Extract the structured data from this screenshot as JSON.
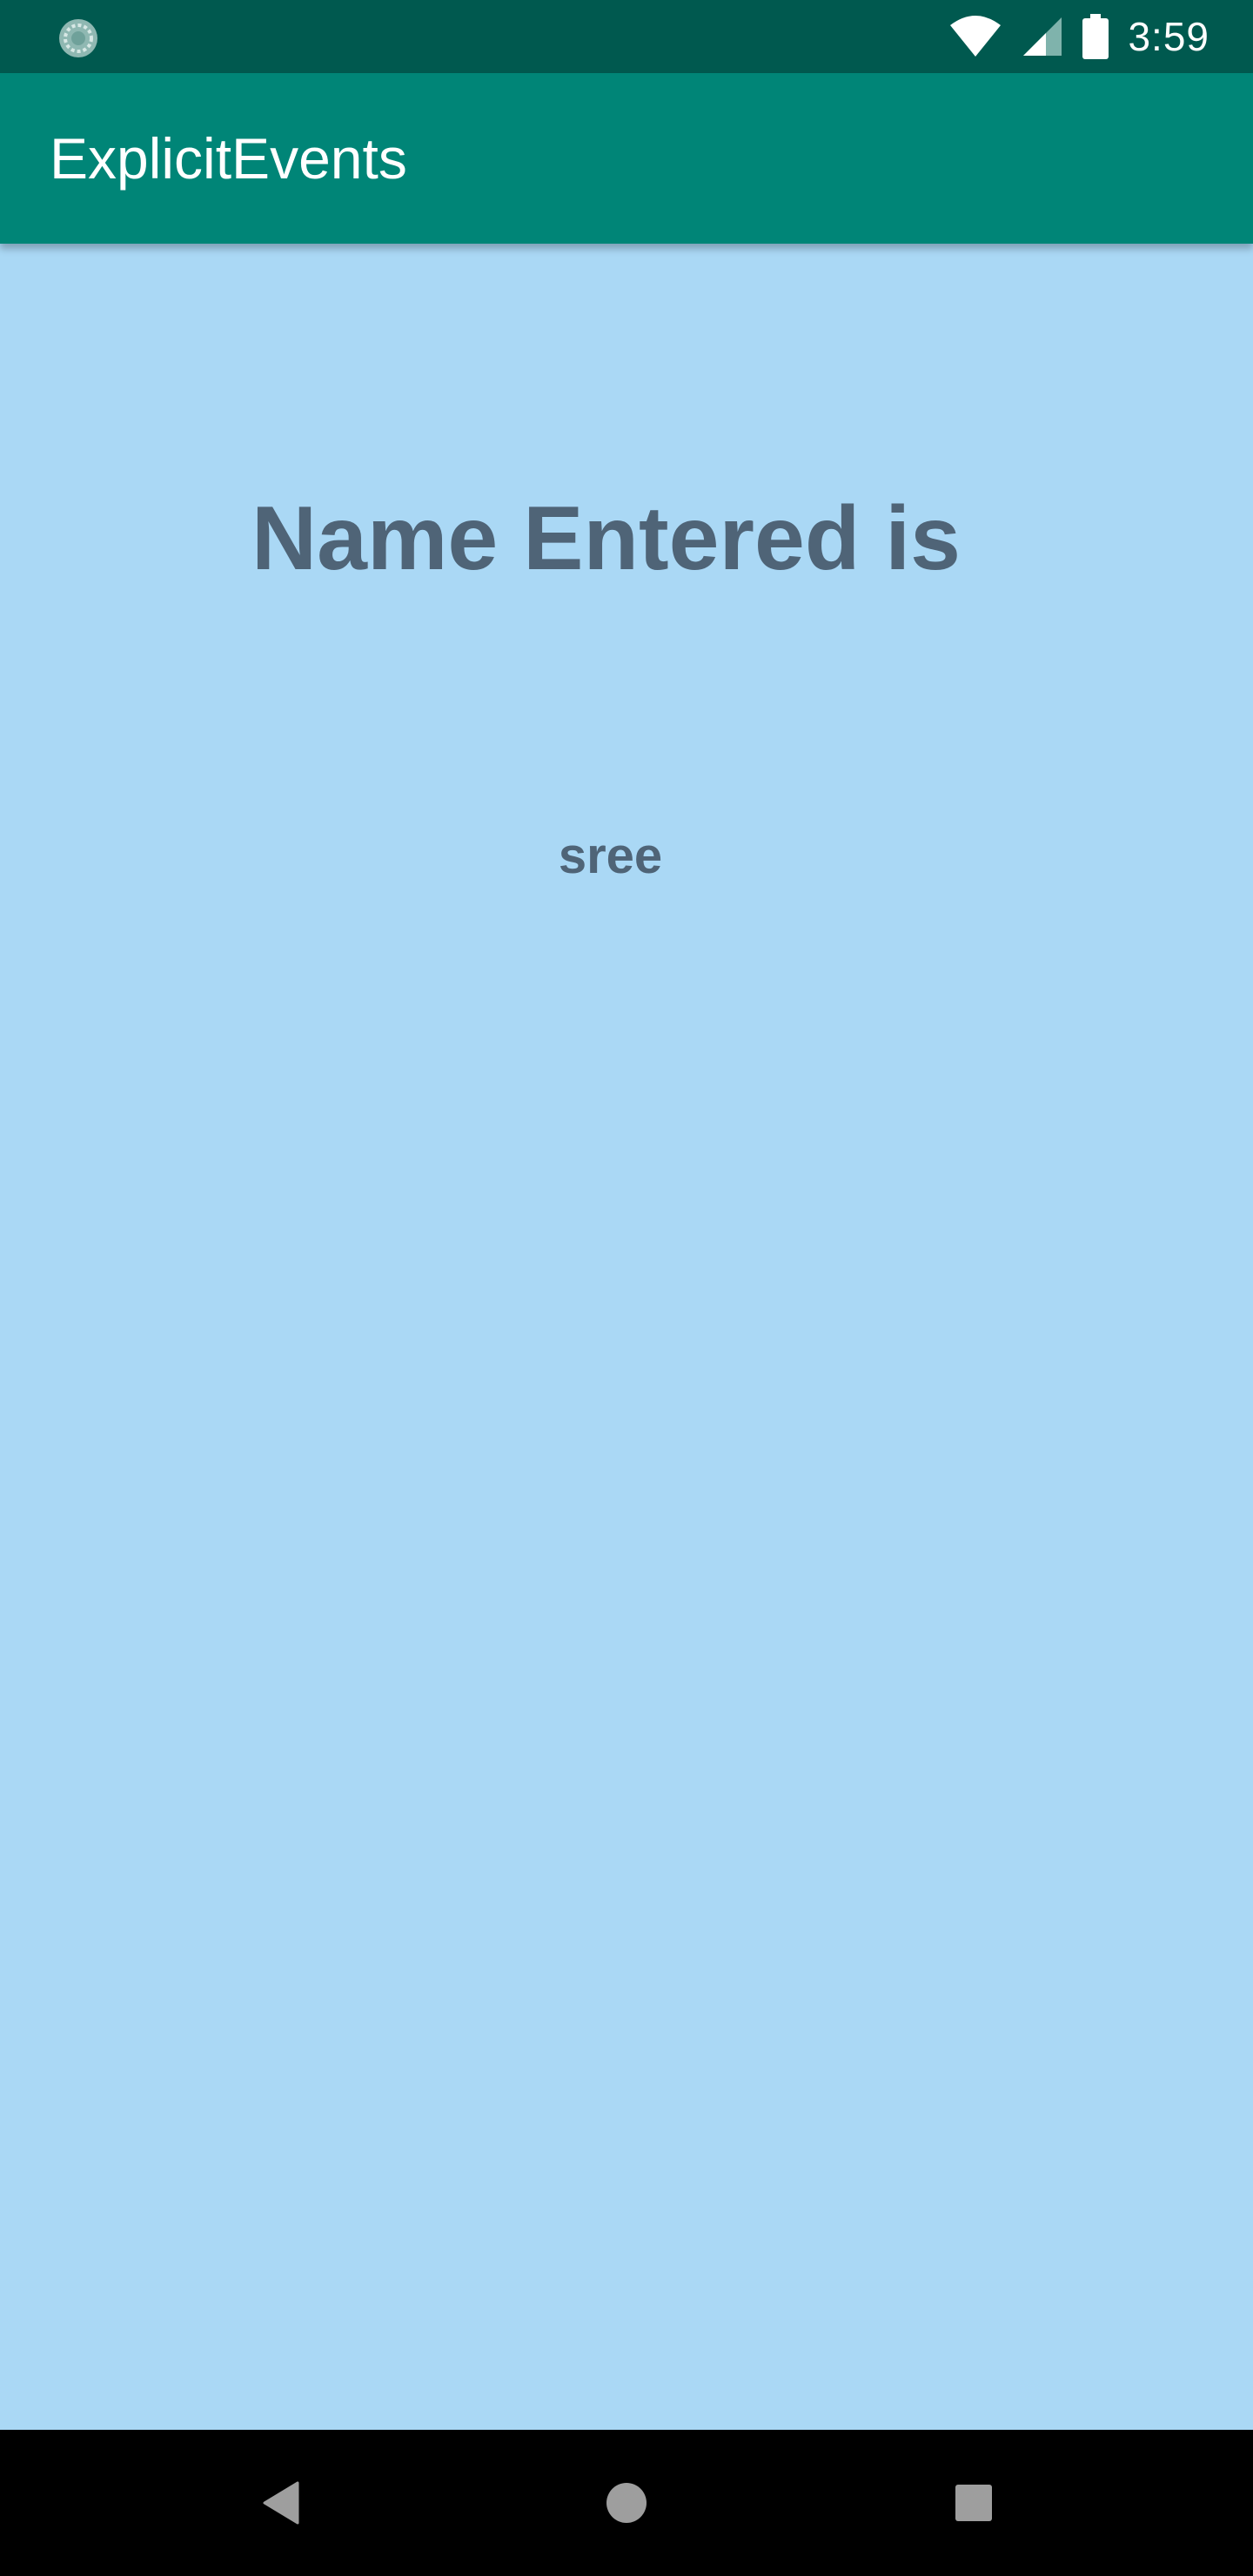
{
  "status_bar": {
    "time": "3:59",
    "icons": [
      "sync-icon",
      "wifi-icon",
      "signal-icon",
      "battery-icon"
    ]
  },
  "app_bar": {
    "title": "ExplicitEvents"
  },
  "content": {
    "heading": "Name Entered is",
    "name_value": "sree"
  },
  "nav_bar": {
    "buttons": [
      "back-icon",
      "home-icon",
      "recents-icon"
    ]
  },
  "colors": {
    "status_bar": "#00594f",
    "app_bar": "#008577",
    "background": "#aad8f5",
    "text": "#4f6477",
    "nav_bar": "#000000"
  }
}
